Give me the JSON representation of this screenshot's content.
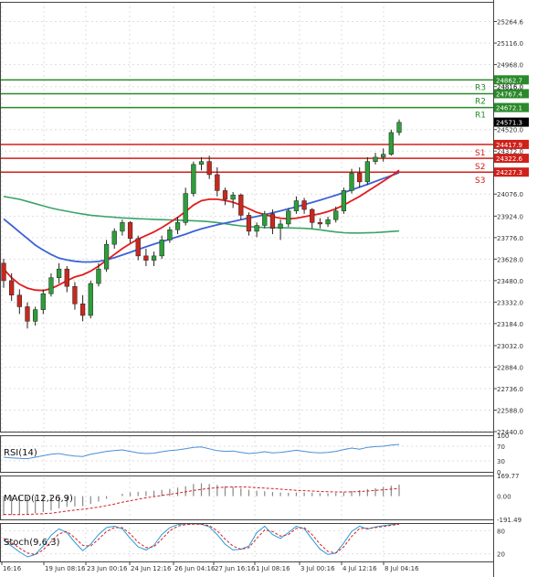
{
  "colors": {
    "bull": "#2e9e3a",
    "bear": "#c8281e",
    "resistance": "#2a8a2a",
    "support": "#d0201a",
    "ema_fast": "#e21c1c",
    "ema_mid": "#3c63d6",
    "ema_slow": "#3aa466",
    "rsi": "#4a8fd6",
    "macd_hist": "#888888",
    "macd_signal": "#d22020",
    "stoch_k": "#2a9ad8",
    "stoch_d": "#d22020",
    "grid": "#dedede"
  },
  "chart_data": [
    {
      "type": "candlestick",
      "panel": "price",
      "ylim": [
        22440,
        25400
      ],
      "yticks": [
        "25264.6",
        "25116.0",
        "24968.0",
        "24816.0",
        "24520.0",
        "24372.0",
        "24076.0",
        "23924.0",
        "23776.0",
        "23628.0",
        "23480.0",
        "23332.0",
        "23184.0",
        "23032.0",
        "22884.0",
        "22736.0",
        "22588.0",
        "22440.0"
      ],
      "xlabels": [
        "16:16",
        "19 Jun 08:16",
        "23 Jun 00:16",
        "24 Jun 12:16",
        "26 Jun 04:16",
        "27 Jun 16:16",
        "1 Jul 08:16",
        "3 Jul 00:16",
        "4 Jul 12:16",
        "8 Jul 04:16"
      ],
      "levels": [
        {
          "name": "R3",
          "value": 24862.7,
          "label": "24862.7",
          "kind": "resistance"
        },
        {
          "name": "",
          "value": 24816.0,
          "label": "24816.0",
          "kind": "axis"
        },
        {
          "name": "R2",
          "value": 24767.4,
          "label": "24767.4",
          "kind": "resistance"
        },
        {
          "name": "R1",
          "value": 24672.1,
          "label": "24672.1",
          "kind": "resistance"
        },
        {
          "name": "",
          "value": 24571.3,
          "label": "24571.3",
          "kind": "current"
        },
        {
          "name": "S1",
          "value": 24417.9,
          "label": "24417.9",
          "kind": "support"
        },
        {
          "name": "S2",
          "value": 24322.6,
          "label": "24322.6",
          "kind": "support"
        },
        {
          "name": "S3",
          "value": 24227.3,
          "label": "24227.3",
          "kind": "support"
        }
      ],
      "candles": [
        [
          23600,
          23630,
          23430,
          23480
        ],
        [
          23480,
          23530,
          23340,
          23380
        ],
        [
          23380,
          23420,
          23250,
          23300
        ],
        [
          23300,
          23330,
          23150,
          23200
        ],
        [
          23200,
          23300,
          23170,
          23280
        ],
        [
          23280,
          23420,
          23250,
          23390
        ],
        [
          23390,
          23530,
          23370,
          23500
        ],
        [
          23500,
          23600,
          23460,
          23560
        ],
        [
          23560,
          23580,
          23400,
          23440
        ],
        [
          23440,
          23470,
          23280,
          23320
        ],
        [
          23320,
          23380,
          23200,
          23240
        ],
        [
          23240,
          23480,
          23220,
          23460
        ],
        [
          23460,
          23600,
          23440,
          23560
        ],
        [
          23560,
          23760,
          23540,
          23730
        ],
        [
          23730,
          23840,
          23700,
          23820
        ],
        [
          23820,
          23900,
          23790,
          23880
        ],
        [
          23880,
          23890,
          23740,
          23770
        ],
        [
          23770,
          23790,
          23620,
          23650
        ],
        [
          23650,
          23700,
          23580,
          23620
        ],
        [
          23620,
          23680,
          23580,
          23650
        ],
        [
          23650,
          23790,
          23630,
          23760
        ],
        [
          23760,
          23850,
          23740,
          23830
        ],
        [
          23830,
          23920,
          23800,
          23880
        ],
        [
          23880,
          24120,
          23860,
          24080
        ],
        [
          24080,
          24300,
          24060,
          24280
        ],
        [
          24280,
          24330,
          24240,
          24300
        ],
        [
          24300,
          24340,
          24180,
          24210
        ],
        [
          24210,
          24260,
          24060,
          24100
        ],
        [
          24100,
          24120,
          24000,
          24040
        ],
        [
          24040,
          24090,
          23980,
          24070
        ],
        [
          24070,
          24080,
          23900,
          23930
        ],
        [
          23930,
          23950,
          23790,
          23820
        ],
        [
          23820,
          23880,
          23780,
          23860
        ],
        [
          23860,
          23960,
          23840,
          23940
        ],
        [
          23940,
          23970,
          23800,
          23840
        ],
        [
          23840,
          23900,
          23760,
          23870
        ],
        [
          23870,
          23980,
          23850,
          23960
        ],
        [
          23960,
          24060,
          23940,
          24030
        ],
        [
          24030,
          24050,
          23940,
          23970
        ],
        [
          23970,
          23980,
          23840,
          23880
        ],
        [
          23880,
          23910,
          23840,
          23870
        ],
        [
          23870,
          23920,
          23850,
          23900
        ],
        [
          23900,
          23990,
          23880,
          23960
        ],
        [
          23960,
          24120,
          23940,
          24100
        ],
        [
          24100,
          24250,
          24080,
          24220
        ],
        [
          24220,
          24260,
          24120,
          24160
        ],
        [
          24160,
          24330,
          24140,
          24300
        ],
        [
          24300,
          24360,
          24280,
          24330
        ],
        [
          24330,
          24390,
          24300,
          24350
        ],
        [
          24350,
          24520,
          24340,
          24500
        ],
        [
          24500,
          24590,
          24480,
          24570
        ]
      ],
      "ema_fast": [
        23560,
        23500,
        23455,
        23428,
        23415,
        23412,
        23425,
        23450,
        23480,
        23505,
        23520,
        23545,
        23580,
        23620,
        23660,
        23700,
        23735,
        23765,
        23790,
        23815,
        23845,
        23880,
        23915,
        23955,
        24000,
        24030,
        24040,
        24040,
        24032,
        24020,
        24000,
        23975,
        23950,
        23935,
        23920,
        23910,
        23905,
        23910,
        23920,
        23930,
        23940,
        23955,
        23975,
        24000,
        24030,
        24060,
        24095,
        24130,
        24165,
        24200,
        24240
      ],
      "ema_mid": [
        23905,
        23860,
        23815,
        23770,
        23725,
        23690,
        23660,
        23635,
        23622,
        23613,
        23608,
        23608,
        23612,
        23622,
        23638,
        23656,
        23675,
        23694,
        23713,
        23731,
        23748,
        23765,
        23782,
        23800,
        23819,
        23836,
        23851,
        23864,
        23876,
        23887,
        23899,
        23911,
        23922,
        23934,
        23947,
        23960,
        23974,
        23988,
        24003,
        24018,
        24034,
        24051,
        24068,
        24086,
        24105,
        24124,
        24143,
        24163,
        24183,
        24203,
        24223
      ],
      "ema_slow": [
        24060,
        24050,
        24040,
        24025,
        24010,
        23995,
        23980,
        23968,
        23958,
        23948,
        23938,
        23930,
        23925,
        23920,
        23916,
        23912,
        23909,
        23906,
        23904,
        23902,
        23900,
        23898,
        23896,
        23894,
        23892,
        23890,
        23886,
        23880,
        23872,
        23864,
        23857,
        23852,
        23848,
        23846,
        23845,
        23844,
        23843,
        23842,
        23840,
        23836,
        23830,
        23822,
        23815,
        23810,
        23808,
        23808,
        23809,
        23811,
        23814,
        23818,
        23822
      ]
    },
    {
      "type": "line",
      "panel": "rsi",
      "title": "RSI(14)",
      "ylim": [
        0,
        100
      ],
      "yticks": [
        "100",
        "70",
        "30",
        "0"
      ],
      "values": [
        40,
        38,
        37,
        36,
        40,
        44,
        48,
        50,
        46,
        43,
        42,
        48,
        52,
        56,
        58,
        60,
        56,
        52,
        50,
        51,
        55,
        58,
        60,
        63,
        67,
        68,
        63,
        58,
        56,
        57,
        53,
        50,
        52,
        55,
        52,
        53,
        56,
        59,
        56,
        53,
        52,
        53,
        56,
        61,
        65,
        62,
        67,
        69,
        70,
        73,
        75
      ]
    },
    {
      "type": "bar",
      "panel": "macd",
      "title": "MACD(12,26,9)",
      "ylim": [
        -191.49,
        169.77
      ],
      "yticks": [
        "169.77",
        "0.00",
        "-191.49"
      ],
      "values": [
        -160,
        -155,
        -150,
        -145,
        -140,
        -132,
        -118,
        -100,
        -88,
        -84,
        -82,
        -65,
        -45,
        -22,
        0,
        20,
        30,
        35,
        40,
        45,
        52,
        60,
        70,
        82,
        100,
        105,
        100,
        92,
        82,
        76,
        65,
        52,
        44,
        40,
        34,
        30,
        28,
        30,
        30,
        28,
        25,
        24,
        26,
        32,
        42,
        50,
        58,
        66,
        75,
        85,
        95
      ],
      "signal": [
        -150,
        -152,
        -152,
        -150,
        -148,
        -145,
        -140,
        -132,
        -123,
        -115,
        -108,
        -100,
        -90,
        -78,
        -65,
        -50,
        -38,
        -25,
        -14,
        -4,
        6,
        15,
        25,
        35,
        46,
        56,
        64,
        70,
        74,
        76,
        76,
        74,
        70,
        66,
        62,
        57,
        52,
        48,
        45,
        42,
        39,
        36,
        34,
        34,
        35,
        38,
        42,
        47,
        52,
        58,
        64
      ]
    },
    {
      "type": "line",
      "panel": "stoch",
      "title": "Stoch(9,6,3)",
      "ylim": [
        0,
        100
      ],
      "yticks": [
        "80",
        "20"
      ],
      "values": [
        55,
        40,
        25,
        12,
        18,
        40,
        68,
        85,
        75,
        50,
        28,
        45,
        70,
        88,
        92,
        85,
        60,
        38,
        30,
        42,
        70,
        88,
        96,
        98,
        98,
        97,
        90,
        70,
        45,
        30,
        32,
        40,
        75,
        92,
        70,
        60,
        75,
        92,
        85,
        58,
        32,
        18,
        22,
        48,
        78,
        92,
        84,
        90,
        93,
        96,
        98
      ],
      "signal": [
        60,
        48,
        35,
        22,
        18,
        30,
        52,
        72,
        78,
        62,
        42,
        40,
        58,
        78,
        88,
        88,
        72,
        50,
        36,
        38,
        58,
        80,
        92,
        96,
        97,
        97,
        93,
        80,
        58,
        40,
        32,
        36,
        60,
        82,
        78,
        66,
        70,
        86,
        88,
        70,
        45,
        26,
        22,
        38,
        65,
        86,
        86,
        88,
        91,
        94,
        97
      ]
    }
  ]
}
